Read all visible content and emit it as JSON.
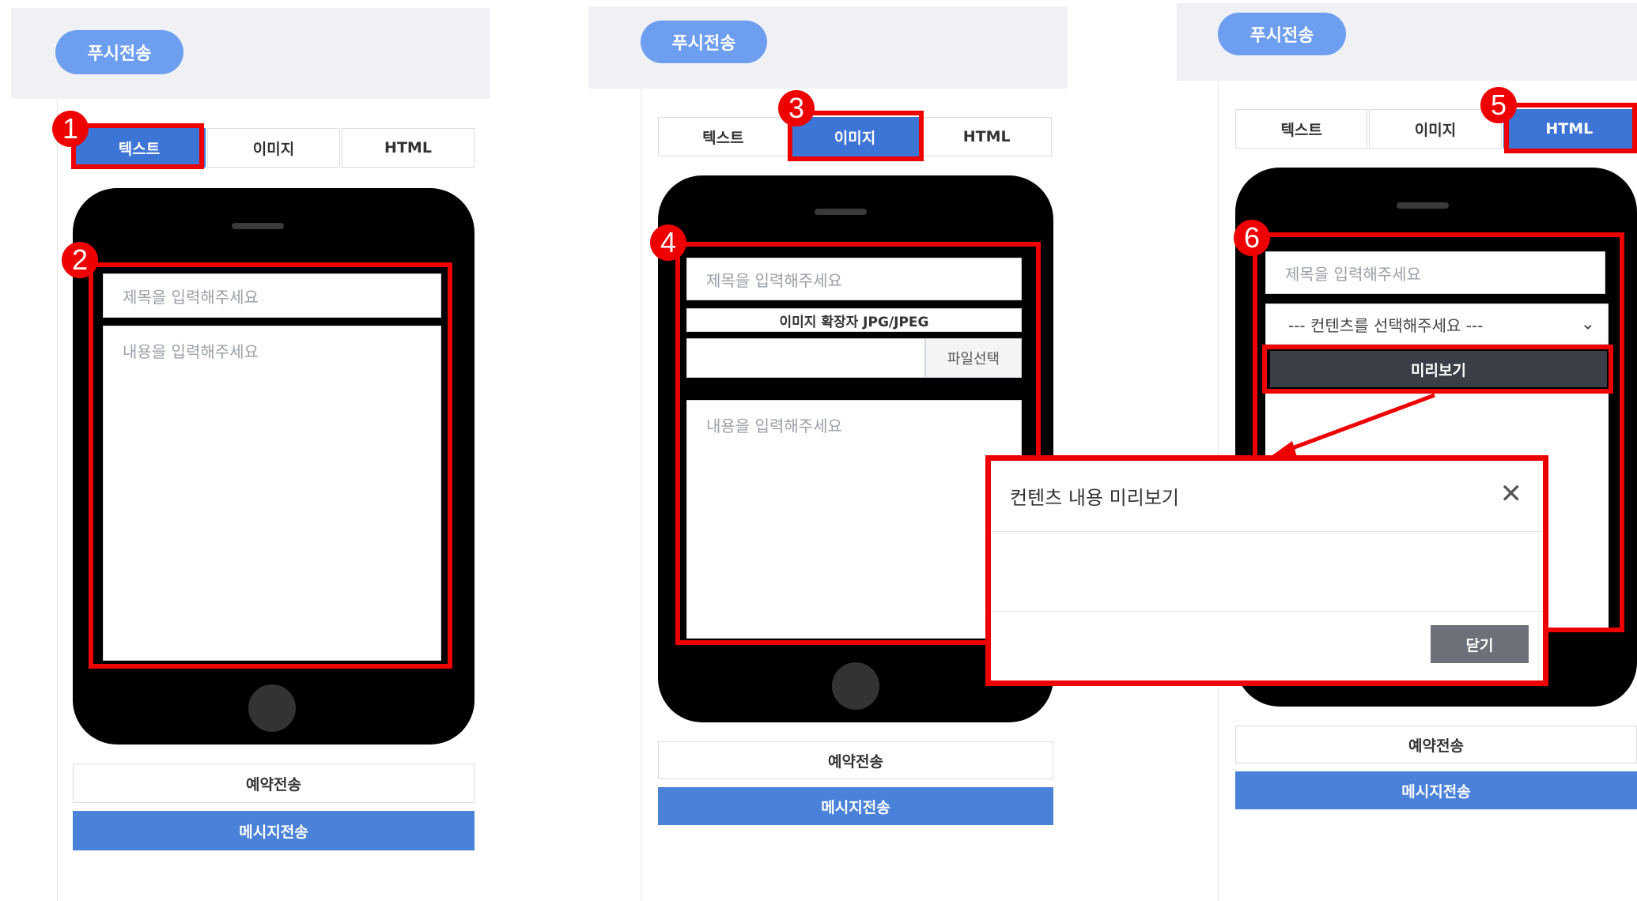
{
  "push_label": "푸시전송",
  "tabs": {
    "text": "텍스트",
    "image": "이미지",
    "html": "HTML"
  },
  "placeholders": {
    "title": "제목을 입력해주세요",
    "content": "내용을 입력해주세요"
  },
  "image_extension_label": "이미지 확장자 JPG/JPEG",
  "file_select_label": "파일선택",
  "content_select_value": "--- 컨텐츠를 선택해주세요 ---",
  "preview_label": "미리보기",
  "reserve_label": "예약전송",
  "send_label": "메시지전송",
  "modal": {
    "title": "컨텐츠 내용 미리보기",
    "close_label": "닫기"
  },
  "badges": [
    "1",
    "2",
    "3",
    "4",
    "5",
    "6"
  ],
  "colors": {
    "accent": "#3d75d6",
    "highlight": "#ee0000",
    "push": "#6d9eef"
  }
}
